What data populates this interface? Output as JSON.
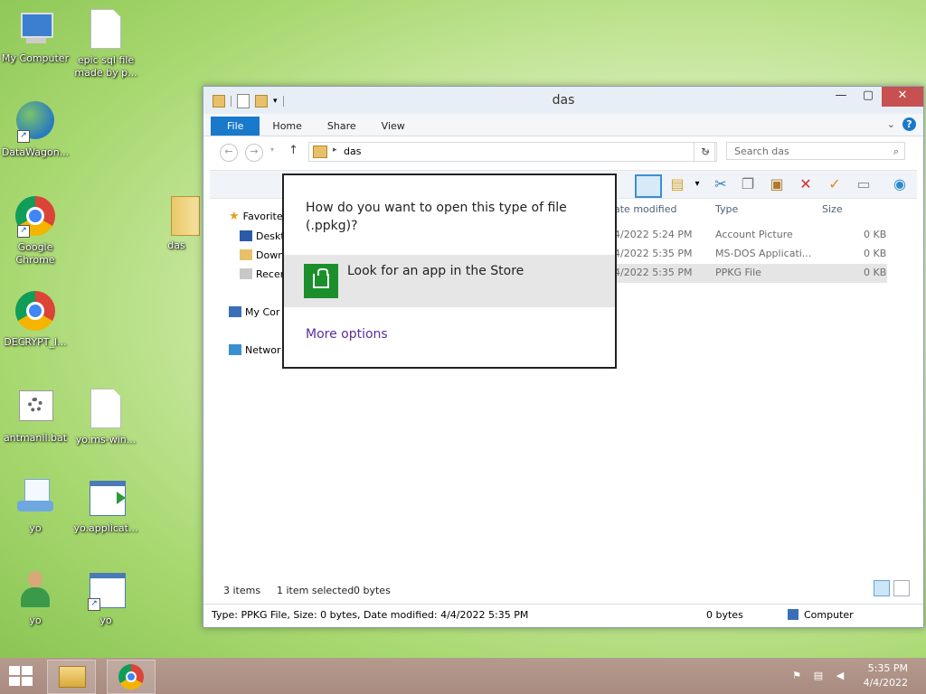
{
  "desktop": {
    "icons": [
      {
        "label": "My Computer"
      },
      {
        "label": "epic sql file made by p..."
      },
      {
        "label": "DataWagon..."
      },
      {
        "label": "Google Chrome"
      },
      {
        "label": "das"
      },
      {
        "label": "DECRYPT_I..."
      },
      {
        "label": "antmanil.bat"
      },
      {
        "label": "yo.ms-win..."
      },
      {
        "label": "yo"
      },
      {
        "label": "yo.applicat..."
      },
      {
        "label": "yo"
      },
      {
        "label": "yo"
      }
    ]
  },
  "window": {
    "title": "das",
    "tabs": {
      "file": "File",
      "home": "Home",
      "share": "Share",
      "view": "View"
    },
    "help": "?",
    "address": {
      "path": "das",
      "sep": "▸"
    },
    "search_placeholder": "Search das",
    "nav": {
      "favorites": "Favorite",
      "desktop": "Deskt",
      "downloads": "Down",
      "recent": "Recen",
      "mycomputer": "My Cor",
      "network": "Networ"
    },
    "columns": {
      "date": "ate modified",
      "type": "Type",
      "size": "Size"
    },
    "rows": [
      {
        "date": "4/2022 5:24 PM",
        "type": "Account Picture",
        "size": "0 KB"
      },
      {
        "date": "4/2022 5:35 PM",
        "type": "MS-DOS Applicati...",
        "size": "0 KB"
      },
      {
        "date": "4/2022 5:35 PM",
        "type": "PPKG File",
        "size": "0 KB"
      }
    ],
    "status": {
      "items": "3 items",
      "selected": "1 item selected",
      "bytes": "0 bytes"
    },
    "details": {
      "info": "Type: PPKG File, Size: 0 bytes, Date modified: 4/4/2022 5:35 PM",
      "size": "0 bytes",
      "location": "Computer"
    }
  },
  "dialog": {
    "question": "How do you want to open this type of file (.ppkg)?",
    "store_option": "Look for an app in the Store",
    "more_options": "More options"
  },
  "taskbar": {
    "time": "5:35 PM",
    "date": "4/4/2022"
  },
  "colors": {
    "accent": "#1979ca",
    "store_green": "#1b8f2c",
    "link_purple": "#5a2d9a"
  }
}
